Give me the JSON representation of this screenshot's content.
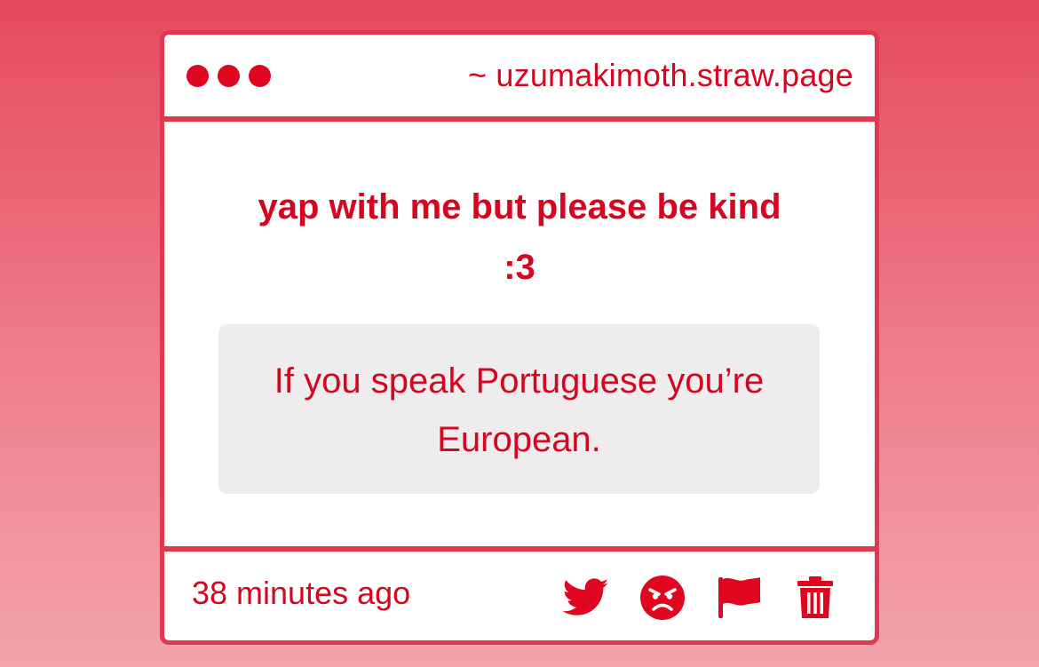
{
  "window": {
    "site": "~ uzumakimoth.straw.page"
  },
  "question": {
    "text_line1": "yap with me but please be kind",
    "text_line2": ":3"
  },
  "answer": {
    "text_line1": "If you speak Portuguese you’re",
    "text_line2": "European."
  },
  "footer": {
    "timestamp": "38 minutes ago",
    "actions": [
      "twitter-icon",
      "angry-face-icon",
      "flag-icon",
      "trash-icon"
    ]
  },
  "colors": {
    "accent": "#e1061f",
    "border": "#e2384f",
    "answer_bg": "#eeecec"
  }
}
